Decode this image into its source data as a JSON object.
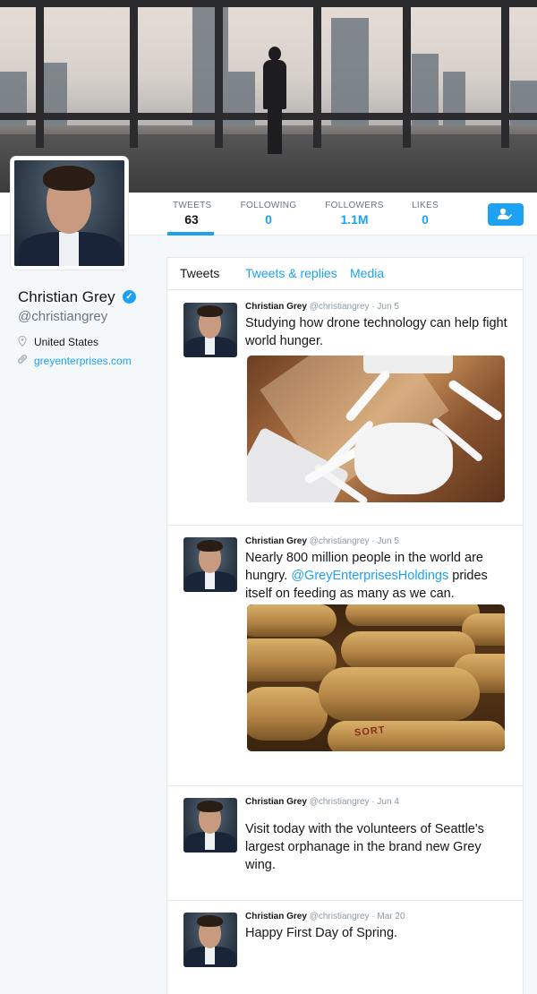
{
  "colors": {
    "accent": "#1da1f2",
    "background": "#f5f8fa",
    "text": "#14171a",
    "muted": "#657786"
  },
  "stats": [
    {
      "label": "TWEETS",
      "value": "63"
    },
    {
      "label": "FOLLOWING",
      "value": "0"
    },
    {
      "label": "FOLLOWERS",
      "value": "1.1M"
    },
    {
      "label": "LIKES",
      "value": "0"
    }
  ],
  "follow_button_icon": "add-user-icon",
  "profile": {
    "name": "Christian Grey",
    "handle": "@christiangrey",
    "location": "United States",
    "website": "greyenterprises.com",
    "verified_icon": "verified-badge-icon"
  },
  "tabs": [
    "Tweets",
    "Tweets & replies",
    "Media"
  ],
  "tweets": [
    {
      "name": "Christian Grey",
      "handle": "@christiangrey",
      "date": "· Jun 5",
      "text": "Studying how drone technology can help fight world hunger.",
      "media": "drone-photo"
    },
    {
      "name": "Christian Grey",
      "handle": "@christiangrey",
      "date": "· Jun 5",
      "text_before": "Nearly 800 million people in the world are hungry. ",
      "mention": "@GreyEnterprisesHoldings",
      "text_after": " prides itself on feeding as many as we can.",
      "media": "grain-sacks-photo",
      "media_label": "SORT"
    },
    {
      "name": "Christian Grey",
      "handle": "@christiangrey",
      "date": "· Jun 4",
      "text": "Visit today with the volunteers of Seattle's largest orphanage in the brand new Grey wing."
    },
    {
      "name": "Christian Grey",
      "handle": "@christiangrey",
      "date": "· Mar 20",
      "text": "Happy First Day of Spring."
    }
  ]
}
